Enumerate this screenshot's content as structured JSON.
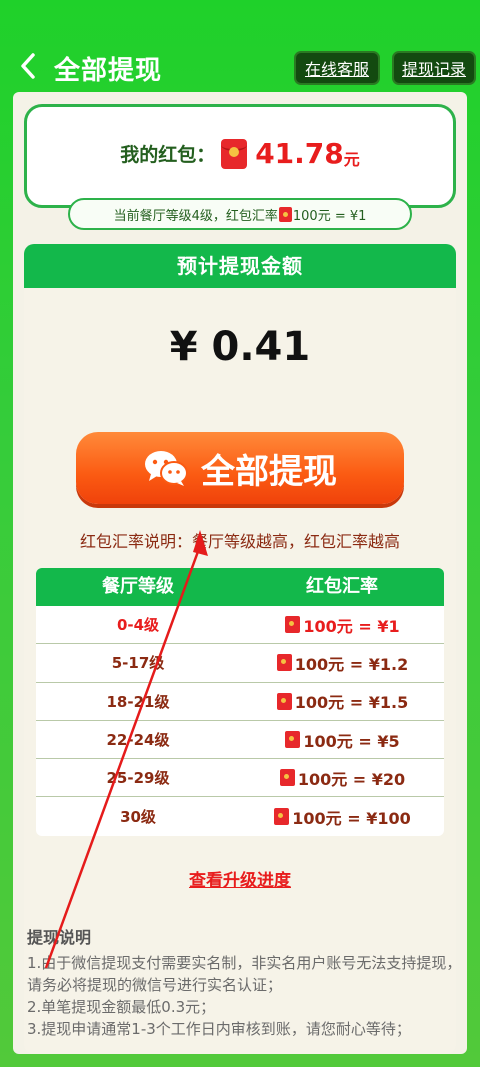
{
  "header": {
    "title": "全部提现",
    "service_label": "在线客服",
    "record_label": "提现记录"
  },
  "balance": {
    "label": "我的红包：",
    "value": "41.78",
    "unit": "元"
  },
  "level_note": {
    "prefix": "当前餐厅等级4级，红包汇率",
    "suffix": "100元 = ¥1"
  },
  "estimate": {
    "header": "预计提现金额",
    "amount": "¥ 0.41",
    "button_label": "全部提现",
    "rate_desc": "红包汇率说明：餐厅等级越高，红包汇率越高"
  },
  "rate_table": {
    "col_level": "餐厅等级",
    "col_rate": "红包汇率",
    "rows": [
      {
        "level": "0-4级",
        "rate": "100元 = ¥1"
      },
      {
        "level": "5-17级",
        "rate": "100元 = ¥1.2"
      },
      {
        "level": "18-21级",
        "rate": "100元 = ¥1.5"
      },
      {
        "level": "22-24级",
        "rate": "100元 = ¥5"
      },
      {
        "level": "25-29级",
        "rate": "100元 = ¥20"
      },
      {
        "level": "30级",
        "rate": "100元 = ¥100"
      }
    ]
  },
  "progress_link": "查看升级进度",
  "notes": {
    "title": "提现说明",
    "items": [
      "1.由于微信提现支付需要实名制，非实名用户账号无法支持提现，请务必将提现的微信号进行实名认证；",
      "2.单笔提现金额最低0.3元；",
      "3.提现申请通常1-3个工作日内审核到账，请您耐心等待；"
    ]
  },
  "colors": {
    "brand_green": "#13b84b",
    "accent_red": "#e81d1d",
    "button_orange": "#fb5a12"
  }
}
